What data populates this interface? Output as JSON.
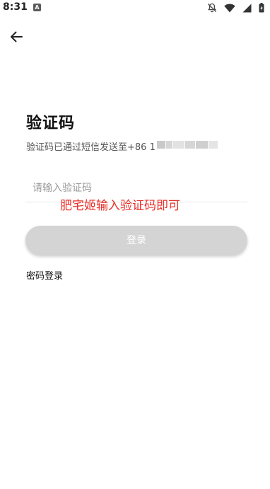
{
  "status_bar": {
    "time": "8:31",
    "app_icon_letter": "A",
    "icons": [
      "notifications-off-icon",
      "wifi-icon",
      "signal-icon",
      "battery-icon"
    ]
  },
  "header": {
    "back_icon": "arrow-left-icon"
  },
  "main": {
    "title": "验证码",
    "subtitle": "验证码已通过短信发送至+86 1"
  },
  "code_field": {
    "placeholder": "请输入验证码",
    "value": ""
  },
  "overlay_note": "肥宅姬输入验证码即可",
  "login_button": {
    "label": "登录"
  },
  "password_login_link": "密码登录",
  "colors": {
    "note_red": "#e8302a",
    "button_disabled": "#d4d4d4",
    "title_text": "#111111"
  }
}
